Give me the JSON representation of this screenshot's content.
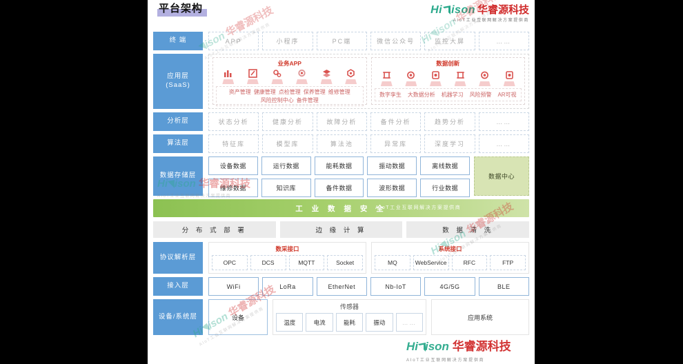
{
  "page": {
    "title": "平台架构"
  },
  "brand": {
    "name_en_1": "Hi",
    "name_en_2": "ison",
    "name_cn": "华睿源科技",
    "tagline": "AIoT工业互联网解决方案提供商",
    "green": "#2aa98b",
    "red": "#d02a2a"
  },
  "layers": {
    "terminal": {
      "label": "终 端",
      "cells": [
        "APP",
        "小程序",
        "PC端",
        "微信公众号",
        "监控大屏",
        "……"
      ]
    },
    "application": {
      "label": "应用层\n(SaaS)",
      "label_line1": "应用层",
      "label_line2": "(SaaS)",
      "groups": [
        {
          "title": "业务APP",
          "icons": [
            "bar-chart-icon",
            "edit-icon",
            "gears-icon",
            "settings-icon",
            "layers-icon",
            "hexagon-icon"
          ],
          "tags_line1": [
            "资产管理",
            "健康管理",
            "点检管理",
            "保养管理",
            "维修管理"
          ],
          "tags_line2": [
            "风险控制中心",
            "备件管理"
          ]
        },
        {
          "title": "数据创新",
          "icons": [
            "digital-twin-icon",
            "bigdata-icon",
            "machine-learning-icon",
            "digital-twin-icon",
            "bigdata-icon",
            "ar-icon"
          ],
          "tags_line1": [
            "数字孪生",
            "大数据分析",
            "机器学习",
            "风险预警",
            "AR可视"
          ],
          "tags_line2": []
        }
      ]
    },
    "analysis": {
      "label": "分析层",
      "cells": [
        "状态分析",
        "健康分析",
        "故障分析",
        "备件分析",
        "趋势分析",
        "……"
      ]
    },
    "algorithm": {
      "label": "算法层",
      "cells": [
        "特征库",
        "模型库",
        "算法池",
        "异常库",
        "深度学习",
        "……"
      ]
    },
    "storage": {
      "label": "数据存储层",
      "row1": [
        "设备数据",
        "运行数据",
        "能耗数据",
        "振动数据",
        "离线数据"
      ],
      "row2": [
        "维修数据",
        "知识库",
        "备件数据",
        "波形数据",
        "行业数据"
      ],
      "data_center": "数据中心",
      "data_center_color": "#d8e4b4"
    },
    "security_band": {
      "text": "工 业 数 据 安 全",
      "color": "#8cc152"
    },
    "platform_capabilities": [
      "分 布 式 部 署",
      "边 缘 计 算",
      "数 据 清 洗"
    ],
    "protocol": {
      "label": "协议解析层",
      "groups": [
        {
          "title": "数采接口",
          "cells": [
            "OPC",
            "DCS",
            "MQTT",
            "Socket"
          ]
        },
        {
          "title": "系统接口",
          "cells": [
            "MQ",
            "WebService",
            "RFC",
            "FTP"
          ]
        }
      ]
    },
    "access": {
      "label": "接入层",
      "cells": [
        "WiFi",
        "LoRa",
        "EtherNet",
        "Nb-IoT",
        "4G/5G",
        "BLE"
      ]
    },
    "device": {
      "label": "设备/系统层",
      "equipment": "设备",
      "sensor_title": "传感器",
      "sensors": [
        "温度",
        "电流",
        "能耗",
        "振动",
        "……"
      ],
      "system_title": "应用系统"
    }
  }
}
